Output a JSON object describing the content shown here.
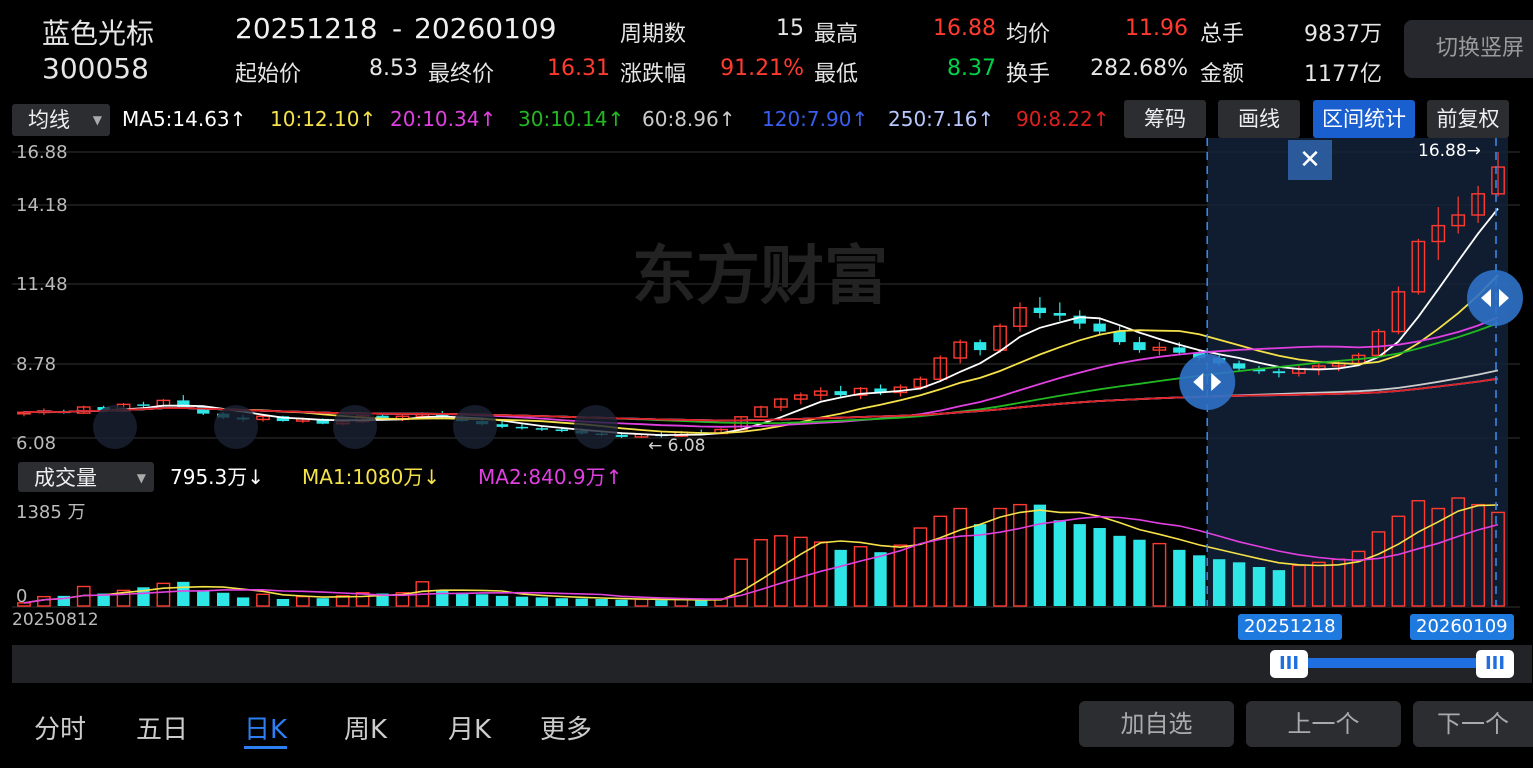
{
  "header": {
    "stock_name": "蓝色光标",
    "stock_code": "300058",
    "date_range_start": "20251218",
    "date_range_sep": "-",
    "date_range_end": "20260109",
    "period_label": "周期数",
    "period_value": "15",
    "high_label": "最高",
    "high_value": "16.88",
    "avg_label": "均价",
    "avg_value": "11.96",
    "total_vol_label": "总手",
    "total_vol_value": "9837万",
    "start_label": "起始价",
    "start_value": "8.53",
    "end_label": "最终价",
    "end_value": "16.31",
    "change_label": "涨跌幅",
    "change_value": "91.21%",
    "low_label": "最低",
    "low_value": "8.37",
    "turnover_label": "换手",
    "turnover_value": "282.68%",
    "amount_label": "金额",
    "amount_value": "1177亿",
    "switch_button": "切换竖屏"
  },
  "toolbar": {
    "indicator_select": "均线",
    "ma_items": [
      {
        "text": "MA5:14.63↑",
        "color": "#ffffff"
      },
      {
        "text": "10:12.10↑",
        "color": "#f5e14a"
      },
      {
        "text": "20:10.34↑",
        "color": "#e040e0"
      },
      {
        "text": "30:10.14↑",
        "color": "#22b822"
      },
      {
        "text": "60:8.96↑",
        "color": "#cccccc"
      },
      {
        "text": "120:7.90↑",
        "color": "#3a5ff0"
      },
      {
        "text": "250:7.16↑",
        "color": "#b8c8ff"
      },
      {
        "text": "90:8.22↑",
        "color": "#e02020"
      }
    ],
    "btn_chips": "筹码",
    "btn_draw": "画线",
    "btn_range_stats": "区间统计",
    "btn_adjust": "前复权"
  },
  "price_axis": {
    "labels": [
      "16.88",
      "14.18",
      "11.48",
      "8.78",
      "6.08"
    ]
  },
  "watermark": "东方财富",
  "annotations": {
    "high_marker": "16.88→",
    "low_marker": "← 6.08",
    "close_x": "✕"
  },
  "volume_toolbar": {
    "indicator_select": "成交量",
    "vol_value": "795.3万↓",
    "ma1": "MA1:1080万↓",
    "ma2": "MA2:840.9万↑",
    "vol_axis_top": "1385 万",
    "vol_axis_zero": "0"
  },
  "date_start_label": "20250812",
  "range_tags": {
    "start": "20251218",
    "end": "20260109"
  },
  "handle_glyph": "III",
  "bottom": {
    "tabs": [
      "分时",
      "五日",
      "日K",
      "周K",
      "月K",
      "更多"
    ],
    "active_tab": "日K",
    "btn_add": "加自选",
    "btn_prev": "上一个",
    "btn_next": "下一个"
  },
  "colors": {
    "up": "#ff3b30",
    "down": "#2ee6e6",
    "accent": "#1f6fe0"
  },
  "chart_data": {
    "type": "candlestick",
    "price_range": [
      6.08,
      16.88
    ],
    "volume_max": 1385,
    "candles": [
      [
        7.0,
        7.1,
        6.9,
        7.05,
        40
      ],
      [
        7.05,
        7.2,
        6.95,
        7.1,
        120
      ],
      [
        7.1,
        7.15,
        7.0,
        7.02,
        130
      ],
      [
        7.02,
        7.3,
        7.0,
        7.25,
        250
      ],
      [
        7.25,
        7.3,
        7.05,
        7.1,
        160
      ],
      [
        7.1,
        7.4,
        7.05,
        7.35,
        200
      ],
      [
        7.35,
        7.45,
        7.2,
        7.3,
        240
      ],
      [
        7.3,
        7.55,
        7.25,
        7.5,
        290
      ],
      [
        7.5,
        7.7,
        7.2,
        7.25,
        310
      ],
      [
        7.25,
        7.3,
        6.95,
        7.0,
        200
      ],
      [
        7.0,
        7.05,
        6.8,
        6.85,
        170
      ],
      [
        6.85,
        6.95,
        6.7,
        6.78,
        110
      ],
      [
        6.78,
        6.95,
        6.7,
        6.9,
        150
      ],
      [
        6.9,
        6.92,
        6.7,
        6.72,
        90
      ],
      [
        6.72,
        6.85,
        6.65,
        6.8,
        120
      ],
      [
        6.8,
        6.82,
        6.6,
        6.62,
        100
      ],
      [
        6.62,
        6.75,
        6.55,
        6.7,
        130
      ],
      [
        6.7,
        6.95,
        6.65,
        6.92,
        170
      ],
      [
        6.92,
        7.0,
        6.75,
        6.78,
        160
      ],
      [
        6.78,
        6.95,
        6.72,
        6.9,
        170
      ],
      [
        6.9,
        7.05,
        6.82,
        7.0,
        310
      ],
      [
        7.0,
        7.1,
        6.85,
        6.88,
        200
      ],
      [
        6.88,
        6.95,
        6.7,
        6.72,
        170
      ],
      [
        6.72,
        6.8,
        6.55,
        6.6,
        150
      ],
      [
        6.6,
        6.7,
        6.45,
        6.5,
        130
      ],
      [
        6.5,
        6.6,
        6.4,
        6.45,
        120
      ],
      [
        6.45,
        6.55,
        6.35,
        6.4,
        110
      ],
      [
        6.4,
        6.5,
        6.3,
        6.35,
        100
      ],
      [
        6.35,
        6.45,
        6.2,
        6.25,
        95
      ],
      [
        6.25,
        6.35,
        6.15,
        6.2,
        90
      ],
      [
        6.2,
        6.3,
        6.08,
        6.12,
        80
      ],
      [
        6.12,
        6.25,
        6.08,
        6.22,
        85
      ],
      [
        6.22,
        6.3,
        6.1,
        6.15,
        75
      ],
      [
        6.15,
        6.35,
        6.12,
        6.3,
        80
      ],
      [
        6.3,
        6.4,
        6.2,
        6.25,
        70
      ],
      [
        6.25,
        6.45,
        6.22,
        6.4,
        90
      ],
      [
        6.4,
        6.9,
        6.38,
        6.88,
        600
      ],
      [
        6.88,
        7.3,
        6.85,
        7.25,
        850
      ],
      [
        7.25,
        7.6,
        7.1,
        7.55,
        900
      ],
      [
        7.55,
        7.8,
        7.35,
        7.7,
        880
      ],
      [
        7.7,
        8.0,
        7.5,
        7.85,
        820
      ],
      [
        7.85,
        8.05,
        7.6,
        7.7,
        720
      ],
      [
        7.7,
        8.0,
        7.55,
        7.95,
        760
      ],
      [
        7.95,
        8.1,
        7.7,
        7.8,
        690
      ],
      [
        7.8,
        8.1,
        7.65,
        8.0,
        780
      ],
      [
        8.0,
        8.4,
        7.9,
        8.3,
        1000
      ],
      [
        8.3,
        9.2,
        8.2,
        9.1,
        1150
      ],
      [
        9.1,
        9.8,
        8.9,
        9.7,
        1250
      ],
      [
        9.7,
        9.8,
        9.2,
        9.4,
        1050
      ],
      [
        9.4,
        10.4,
        9.3,
        10.3,
        1250
      ],
      [
        10.3,
        11.2,
        10.1,
        11.0,
        1300
      ],
      [
        11.0,
        11.4,
        10.6,
        10.8,
        1300
      ],
      [
        10.8,
        11.2,
        10.5,
        10.7,
        1100
      ],
      [
        10.7,
        10.9,
        10.2,
        10.4,
        1050
      ],
      [
        10.4,
        10.6,
        10.0,
        10.1,
        1000
      ],
      [
        10.1,
        10.3,
        9.6,
        9.7,
        900
      ],
      [
        9.7,
        9.9,
        9.3,
        9.4,
        850
      ],
      [
        9.4,
        9.7,
        9.2,
        9.5,
        800
      ],
      [
        9.5,
        9.7,
        9.2,
        9.3,
        720
      ],
      [
        9.3,
        9.4,
        9.0,
        9.1,
        650
      ],
      [
        9.1,
        9.2,
        8.8,
        8.9,
        600
      ],
      [
        8.9,
        9.0,
        8.6,
        8.7,
        560
      ],
      [
        8.7,
        8.8,
        8.5,
        8.6,
        500
      ],
      [
        8.6,
        8.7,
        8.37,
        8.53,
        460
      ],
      [
        8.53,
        8.8,
        8.4,
        8.7,
        520
      ],
      [
        8.7,
        8.9,
        8.45,
        8.8,
        560
      ],
      [
        8.8,
        9.0,
        8.6,
        8.9,
        600
      ],
      [
        8.9,
        9.3,
        8.8,
        9.2,
        700
      ],
      [
        9.2,
        10.2,
        9.1,
        10.1,
        950
      ],
      [
        10.1,
        11.8,
        10.0,
        11.6,
        1150
      ],
      [
        11.6,
        13.6,
        11.5,
        13.5,
        1350
      ],
      [
        13.5,
        14.8,
        12.8,
        14.1,
        1250
      ],
      [
        14.1,
        15.2,
        13.8,
        14.5,
        1385
      ],
      [
        14.5,
        15.6,
        14.2,
        15.3,
        1300
      ],
      [
        15.3,
        16.88,
        15.2,
        16.31,
        1200
      ]
    ]
  }
}
